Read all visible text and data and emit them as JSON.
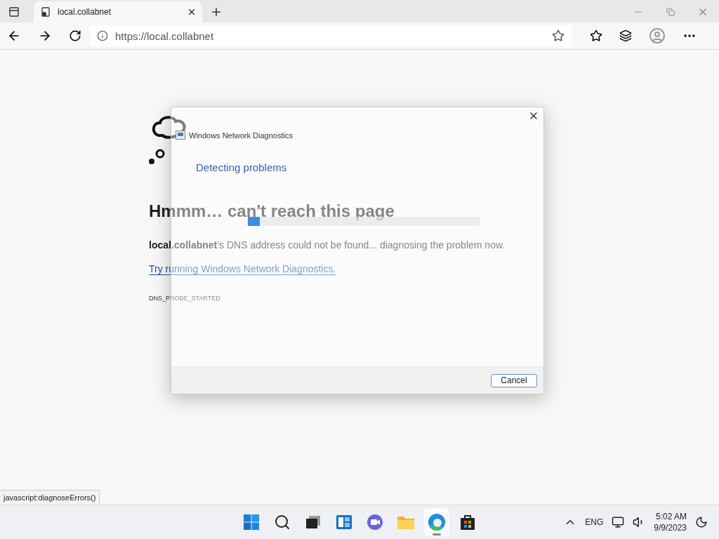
{
  "browser": {
    "tab": {
      "title": "local.collabnet",
      "selected": true
    },
    "address": "https://local.collabnet"
  },
  "page": {
    "heading": "Hmmm… can't reach this page",
    "message": "**local.collabnet**’s DNS address could not be found... diagnosing the problem now.",
    "link": "Try running Windows Network Diagnostics.",
    "code": "DNS_PROBE_STARTED"
  },
  "dialog": {
    "title": "Windows Network Diagnostics",
    "heading": "Detecting problems",
    "progress": {
      "level": 0.05
    },
    "button": "Cancel"
  },
  "status_bar": "javascript:diagnoseErrors()",
  "taskbar": {
    "apps": [
      {
        "kind": "start",
        "selected": false
      },
      {
        "kind": "search",
        "selected": false
      },
      {
        "kind": "taskview",
        "selected": false
      },
      {
        "kind": "widgets",
        "selected": false
      },
      {
        "kind": "chat",
        "selected": false
      },
      {
        "kind": "explorer",
        "selected": false
      },
      {
        "kind": "edge",
        "selected": true
      },
      {
        "kind": "store",
        "selected": false
      }
    ],
    "language": "ENG",
    "time": "5:02 AM",
    "date": "9/9/2023"
  }
}
